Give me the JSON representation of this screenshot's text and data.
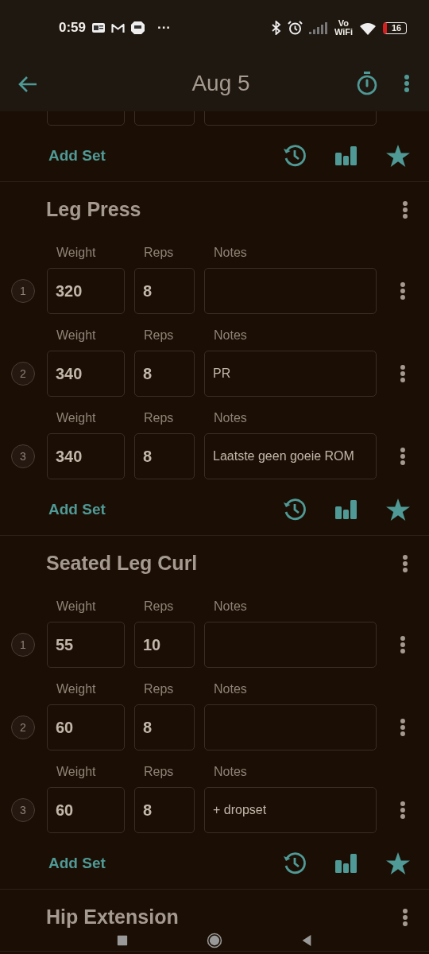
{
  "status_bar": {
    "time": "0:59",
    "more": "···",
    "vowifi_top": "Vo",
    "vowifi_bottom": "WiFi",
    "battery": "16"
  },
  "header": {
    "title": "Aug 5"
  },
  "exercises": [
    {
      "cut_off_top": true,
      "add_set": "Add Set"
    },
    {
      "name": "Leg Press",
      "add_set": "Add Set",
      "sets": [
        {
          "weight_label": "Weight",
          "reps_label": "Reps",
          "notes_label": "Notes",
          "number": "1",
          "weight": "320",
          "reps": "8"
        },
        {
          "weight_label": "Weight",
          "reps_label": "Reps",
          "notes_label": "Notes",
          "number": "2",
          "weight": "340",
          "reps": "8",
          "notes": "PR"
        },
        {
          "weight_label": "Weight",
          "reps_label": "Reps",
          "notes_label": "Notes",
          "number": "3",
          "weight": "340",
          "reps": "8",
          "notes": "Laatste geen goeie ROM"
        }
      ]
    },
    {
      "name": "Seated Leg Curl",
      "add_set": "Add Set",
      "sets": [
        {
          "weight_label": "Weight",
          "reps_label": "Reps",
          "notes_label": "Notes",
          "number": "1",
          "weight": "55",
          "reps": "10"
        },
        {
          "weight_label": "Weight",
          "reps_label": "Reps",
          "notes_label": "Notes",
          "number": "2",
          "weight": "60",
          "reps": "8"
        },
        {
          "weight_label": "Weight",
          "reps_label": "Reps",
          "notes_label": "Notes",
          "number": "3",
          "weight": "60",
          "reps": "8",
          "notes": "+ dropset"
        }
      ]
    },
    {
      "name": "Hip Extension"
    }
  ]
}
